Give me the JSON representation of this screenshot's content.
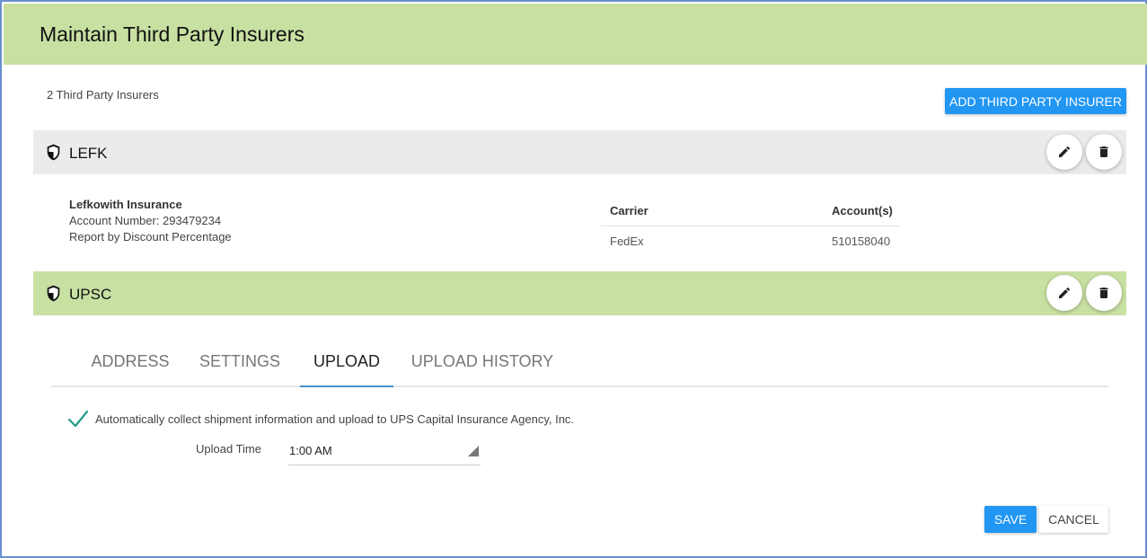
{
  "header": {
    "title": "Maintain Third Party Insurers"
  },
  "summary": {
    "count_text": "2 Third Party Insurers"
  },
  "toolbar": {
    "add_label": "ADD THIRD PARTY INSURER"
  },
  "insurers": [
    {
      "code": "LEFK",
      "name": "Lefkowith Insurance",
      "account_number": "Account Number: 293479234",
      "report_by": "Report by Discount Percentage",
      "table": {
        "columns": [
          "Carrier",
          "Account(s)"
        ],
        "rows": [
          [
            "FedEx",
            "510158040"
          ]
        ]
      }
    },
    {
      "code": "UPSC"
    }
  ],
  "tabs": [
    {
      "label": "ADDRESS"
    },
    {
      "label": "SETTINGS"
    },
    {
      "label": "UPLOAD",
      "active": true
    },
    {
      "label": "UPLOAD HISTORY"
    }
  ],
  "upload": {
    "auto_collect_label": "Automatically collect shipment information and upload to UPS Capital Insurance Agency, Inc.",
    "auto_collect_checked": true,
    "upload_time_label": "Upload Time",
    "upload_time_value": "1:00 AM"
  },
  "actions": {
    "save_label": "SAVE",
    "cancel_label": "CANCEL"
  },
  "icons": {
    "shield": "shield-icon",
    "edit": "pencil-icon",
    "delete": "trash-icon",
    "check": "checkmark-icon",
    "dropdown": "triangle-dropdown-icon"
  },
  "colors": {
    "header_bg": "#c8e0a2",
    "selected_row_bg": "#c8e0a2",
    "row_bg": "#ebebeb",
    "primary": "#2196f3",
    "check": "#1e9b8a",
    "active_tab_underline": "#4a90c8",
    "frame_border": "#6a8fd0"
  }
}
